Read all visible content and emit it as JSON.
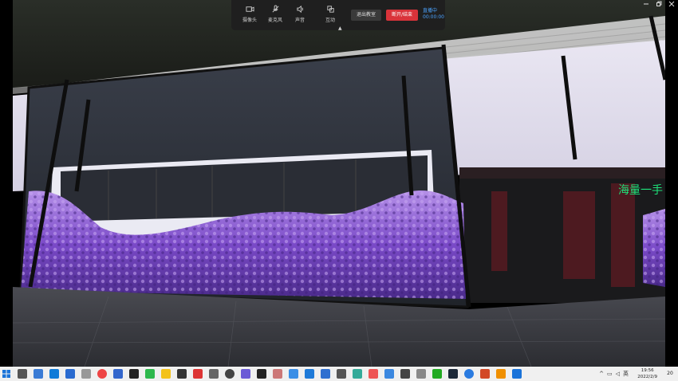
{
  "toolbar": {
    "camera_label": "摄像头",
    "mic_label": "麦克风",
    "speaker_label": "声音",
    "interact_label": "互动",
    "share_label": "退出教室",
    "leave_label": "断开/结束",
    "status_line1": "直播中",
    "status_line2": "00:00:00"
  },
  "watermark": {
    "text": "海量一手"
  },
  "taskbar": {
    "clock_time": "19:56",
    "clock_date": "2022/2/9",
    "notification_count": "20"
  },
  "colors": {
    "toolbar_bg": "#1f1f1f",
    "leave_red": "#d9333a",
    "status_blue": "#4aa3ff",
    "watermark_green": "#1ee37a"
  }
}
